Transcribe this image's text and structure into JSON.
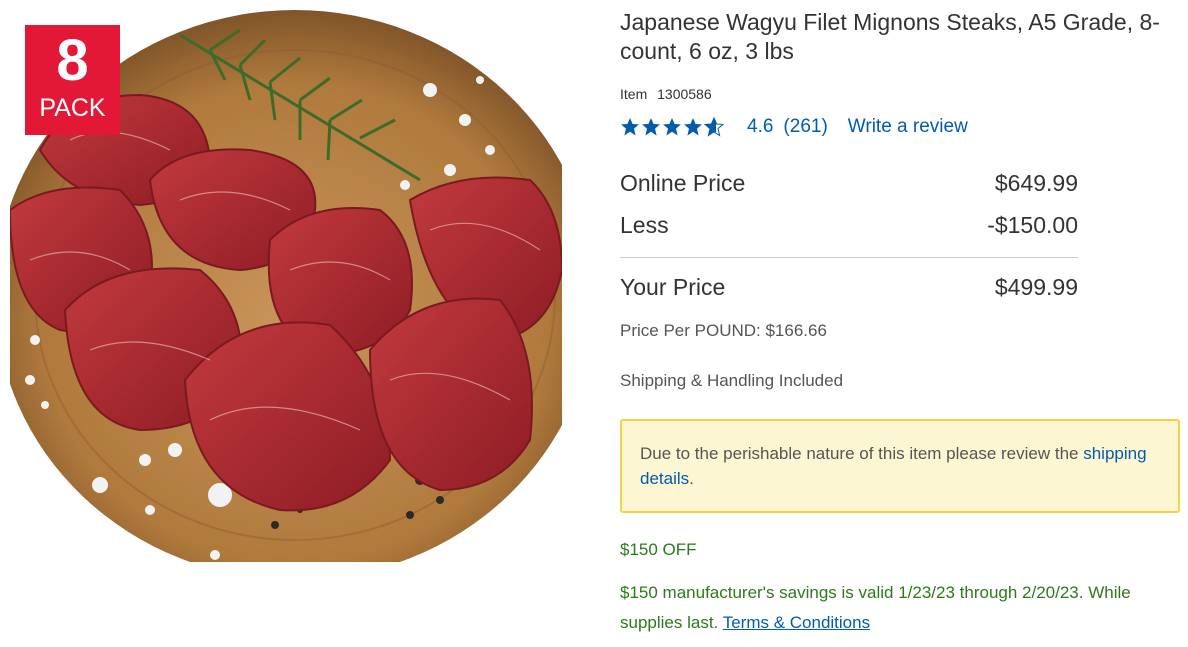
{
  "badge": {
    "number": "8",
    "label": "PACK"
  },
  "product": {
    "title": "Japanese Wagyu Filet Mignons Steaks, A5 Grade, 8-count, 6 oz, 3 lbs",
    "item_label": "Item",
    "item_number": "1300586"
  },
  "rating": {
    "value": "4.6",
    "count": "(261)",
    "stars_out_of_5": 4.6,
    "write_review": "Write a review"
  },
  "pricing": {
    "online_label": "Online Price",
    "online_value": "$649.99",
    "less_label": "Less",
    "less_value": "-$150.00",
    "your_label": "Your Price",
    "your_value": "$499.99",
    "per_unit": "Price Per POUND: $166.66"
  },
  "shipping": {
    "text": "Shipping & Handling Included"
  },
  "notice": {
    "text": "Due to the perishable nature of this item please review the",
    "link": "shipping details",
    "suffix": "."
  },
  "promo": {
    "title": "$150 OFF",
    "text": "$150 manufacturer's savings is valid 1/23/23 through 2/20/23. While supplies last.",
    "link": "Terms & Conditions"
  },
  "colors": {
    "badge_red": "#e31837",
    "link_blue": "#005dab",
    "promo_green": "#2c7a1b",
    "notice_bg": "#fdf6d3",
    "notice_border": "#f2d44b"
  },
  "icons": {
    "star": "star-icon",
    "half_star": "half-star-icon"
  }
}
